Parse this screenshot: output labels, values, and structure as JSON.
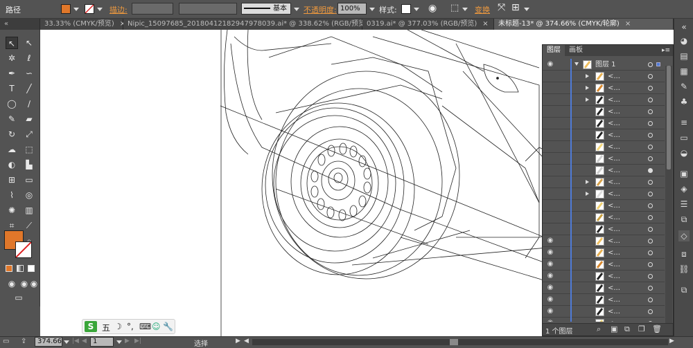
{
  "control_bar": {
    "path_label": "路径",
    "stroke_label": "描边:",
    "style_label": "基本",
    "opacity_label": "不透明度:",
    "opacity_value": "100%",
    "graphic_style_label": "样式:",
    "transform_label": "变换",
    "fill_color": "#e0772a"
  },
  "tabs": [
    {
      "label": "33.33% (CMYK/预览)",
      "close": "×"
    },
    {
      "label": "Nipic_15097685_20180412182947978039.ai* @ 338.62% (RGB/预览)",
      "close": "×"
    },
    {
      "label": "0319.ai* @ 377.03% (RGB/预览)",
      "close": "×"
    },
    {
      "label": "未标题-13* @ 374.66% (CMYK/轮廓)",
      "close": "×"
    }
  ],
  "tools_panel": {
    "tools": [
      "selection-icon",
      "direct-selection-icon",
      "magic-wand-icon",
      "lasso-icon",
      "pen-icon",
      "curvature-icon",
      "type-icon",
      "line-icon",
      "ellipse-icon",
      "paintbrush-icon",
      "pencil-icon",
      "eraser-icon",
      "rotate-icon",
      "scale-icon",
      "warp-icon",
      "free-transform-icon",
      "shape-builder-icon",
      "chart-icon",
      "mesh-icon",
      "gradient-icon",
      "eyedropper-icon",
      "blend-icon",
      "symbol-sprayer-icon",
      "column-graph-icon",
      "artboard-icon",
      "slice-icon",
      "hand-icon",
      "zoom-icon"
    ],
    "fill_color": "#e0772a"
  },
  "layers_panel": {
    "tab_layers": "图层",
    "tab_artboards": "画板",
    "top_layer": "图层 1",
    "sublayer_name": "<...",
    "rows": 24,
    "footer_count": "1 个图层"
  },
  "status_bar": {
    "zoom": "374.66",
    "page": "1",
    "tool_status": "选择"
  },
  "ime": {
    "label": "五"
  }
}
